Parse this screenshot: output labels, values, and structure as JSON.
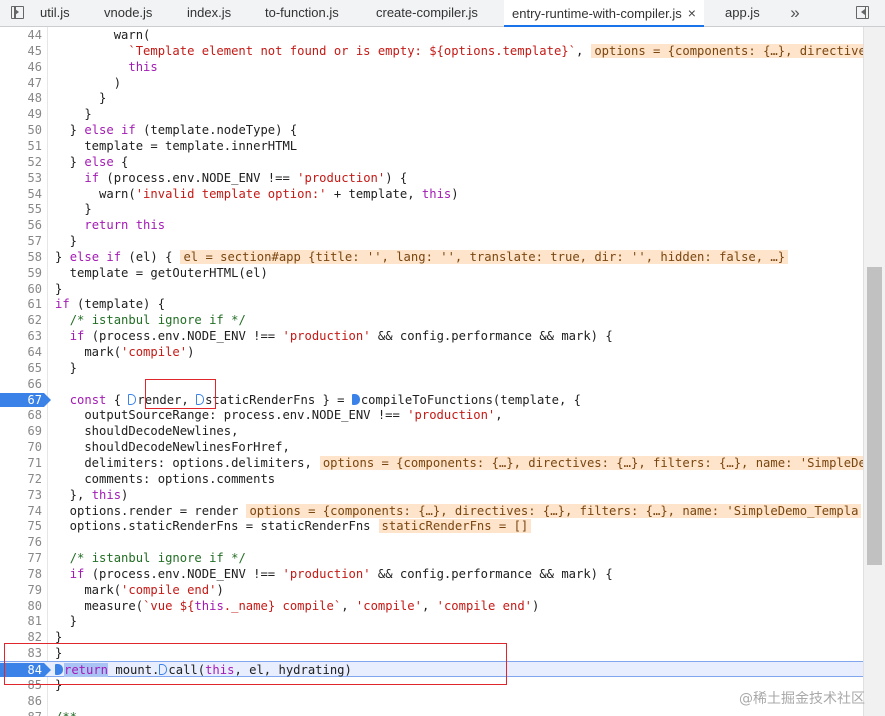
{
  "tabs": [
    {
      "label": "util.js"
    },
    {
      "label": "vnode.js"
    },
    {
      "label": "index.js"
    },
    {
      "label": "to-function.js"
    },
    {
      "label": "create-compiler.js"
    },
    {
      "label": "entry-runtime-with-compiler.js",
      "active": true
    },
    {
      "label": "app.js"
    }
  ],
  "icons": {
    "nav": "navigator-toggle-icon",
    "close": "×",
    "more": "»",
    "toggle_debugger": "debugger-pane-toggle-icon",
    "breakpoint": "breakpoint-marker",
    "inline_breakpoint": "inline-breakpoint-icon"
  },
  "colors": {
    "breakpoint": "#3b82e8",
    "execution_line": "#e8eefe",
    "inline_value": "#fde4cb",
    "highlight_box": "#e0262d"
  },
  "editor": {
    "breakpoint_line": 67,
    "paused_line": 84,
    "lines": [
      {
        "n": "44",
        "segs": [
          [
            "t",
            "        warn("
          ]
        ]
      },
      {
        "n": "45",
        "segs": [
          [
            "t",
            "          "
          ],
          [
            "str",
            "`Template element not found or is empty: ${options.template}`"
          ],
          [
            "t",
            ","
          ],
          [
            "inl",
            "options = {components: {…}, directives: {…}, filters: {…}, name: 'Si"
          ]
        ]
      },
      {
        "n": "46",
        "segs": [
          [
            "t",
            "          "
          ],
          [
            "kw",
            "this"
          ]
        ]
      },
      {
        "n": "47",
        "segs": [
          [
            "t",
            "        )"
          ]
        ]
      },
      {
        "n": "48",
        "segs": [
          [
            "t",
            "      }"
          ]
        ]
      },
      {
        "n": "49",
        "segs": [
          [
            "t",
            "    }"
          ]
        ]
      },
      {
        "n": "50",
        "segs": [
          [
            "t",
            "  } "
          ],
          [
            "kw",
            "else if"
          ],
          [
            "t",
            " (template.nodeType) {"
          ]
        ]
      },
      {
        "n": "51",
        "segs": [
          [
            "t",
            "    template = template.innerHTML"
          ]
        ]
      },
      {
        "n": "52",
        "segs": [
          [
            "t",
            "  } "
          ],
          [
            "kw",
            "else"
          ],
          [
            "t",
            " {"
          ]
        ]
      },
      {
        "n": "53",
        "segs": [
          [
            "t",
            "    "
          ],
          [
            "kw",
            "if"
          ],
          [
            "t",
            " (process.env.NODE_ENV !== "
          ],
          [
            "str",
            "'production'"
          ],
          [
            "t",
            ") {"
          ]
        ]
      },
      {
        "n": "54",
        "segs": [
          [
            "t",
            "      warn("
          ],
          [
            "str",
            "'invalid template option:'"
          ],
          [
            "t",
            " + template, "
          ],
          [
            "kw",
            "this"
          ],
          [
            "t",
            ")"
          ]
        ]
      },
      {
        "n": "55",
        "segs": [
          [
            "t",
            "    }"
          ]
        ]
      },
      {
        "n": "56",
        "segs": [
          [
            "t",
            "    "
          ],
          [
            "kw",
            "return this"
          ]
        ]
      },
      {
        "n": "57",
        "segs": [
          [
            "t",
            "  }"
          ]
        ]
      },
      {
        "n": "58",
        "segs": [
          [
            "t",
            "} "
          ],
          [
            "kw",
            "else if"
          ],
          [
            "t",
            " (el) {"
          ],
          [
            "inl",
            "el = section#app {title: '', lang: '', translate: true, dir: '', hidden: false, …}"
          ]
        ]
      },
      {
        "n": "59",
        "segs": [
          [
            "t",
            "  template = getOuterHTML(el)"
          ]
        ]
      },
      {
        "n": "60",
        "segs": [
          [
            "t",
            "}"
          ]
        ]
      },
      {
        "n": "61",
        "segs": [
          [
            "kw",
            "if"
          ],
          [
            "t",
            " (template) {"
          ]
        ]
      },
      {
        "n": "62",
        "segs": [
          [
            "t",
            "  "
          ],
          [
            "cm",
            "/* istanbul ignore if */"
          ]
        ]
      },
      {
        "n": "63",
        "segs": [
          [
            "t",
            "  "
          ],
          [
            "kw",
            "if"
          ],
          [
            "t",
            " (process.env.NODE_ENV !== "
          ],
          [
            "str",
            "'production'"
          ],
          [
            "t",
            " && config.performance && mark) {"
          ]
        ]
      },
      {
        "n": "64",
        "segs": [
          [
            "t",
            "    mark("
          ],
          [
            "str",
            "'compile'"
          ],
          [
            "t",
            ")"
          ]
        ]
      },
      {
        "n": "65",
        "segs": [
          [
            "t",
            "  }"
          ]
        ]
      },
      {
        "n": "66",
        "segs": []
      },
      {
        "n": "67",
        "segs": [
          [
            "t",
            "  "
          ],
          [
            "kw",
            "const"
          ],
          [
            "t",
            " { "
          ],
          [
            "bk",
            ""
          ],
          [
            "t",
            "render, "
          ],
          [
            "bk",
            ""
          ],
          [
            "t",
            "staticRenderFns } = "
          ],
          [
            "bkf",
            ""
          ],
          [
            "t",
            "compileToFunctions(template, {"
          ]
        ]
      },
      {
        "n": "68",
        "segs": [
          [
            "t",
            "    outputSourceRange: process.env.NODE_ENV !== "
          ],
          [
            "str",
            "'production'"
          ],
          [
            "t",
            ","
          ]
        ]
      },
      {
        "n": "69",
        "segs": [
          [
            "t",
            "    shouldDecodeNewlines,"
          ]
        ]
      },
      {
        "n": "70",
        "segs": [
          [
            "t",
            "    shouldDecodeNewlinesForHref,"
          ]
        ]
      },
      {
        "n": "71",
        "segs": [
          [
            "t",
            "    delimiters: options.delimiters,"
          ],
          [
            "inl",
            "options = {components: {…}, directives: {…}, filters: {…}, name: 'SimpleDemo_Te"
          ]
        ]
      },
      {
        "n": "72",
        "segs": [
          [
            "t",
            "    comments: options.comments"
          ]
        ]
      },
      {
        "n": "73",
        "segs": [
          [
            "t",
            "  }, "
          ],
          [
            "kw",
            "this"
          ],
          [
            "t",
            ")"
          ]
        ]
      },
      {
        "n": "74",
        "segs": [
          [
            "t",
            "  options.render = render"
          ],
          [
            "inl",
            "options = {components: {…}, directives: {…}, filters: {…}, name: 'SimpleDemo_Templa"
          ]
        ]
      },
      {
        "n": "75",
        "segs": [
          [
            "t",
            "  options.staticRenderFns = staticRenderFns"
          ],
          [
            "inl",
            "staticRenderFns = []"
          ]
        ]
      },
      {
        "n": "76",
        "segs": []
      },
      {
        "n": "77",
        "segs": [
          [
            "t",
            "  "
          ],
          [
            "cm",
            "/* istanbul ignore if */"
          ]
        ]
      },
      {
        "n": "78",
        "segs": [
          [
            "t",
            "  "
          ],
          [
            "kw",
            "if"
          ],
          [
            "t",
            " (process.env.NODE_ENV !== "
          ],
          [
            "str",
            "'production'"
          ],
          [
            "t",
            " && config.performance && mark) {"
          ]
        ]
      },
      {
        "n": "79",
        "segs": [
          [
            "t",
            "    mark("
          ],
          [
            "str",
            "'compile end'"
          ],
          [
            "t",
            ")"
          ]
        ]
      },
      {
        "n": "80",
        "segs": [
          [
            "t",
            "    measure("
          ],
          [
            "str",
            "`vue ${"
          ],
          [
            "kw",
            "this"
          ],
          [
            "str",
            "._name} compile`"
          ],
          [
            "t",
            ", "
          ],
          [
            "str",
            "'compile'"
          ],
          [
            "t",
            ", "
          ],
          [
            "str",
            "'compile end'"
          ],
          [
            "t",
            ")"
          ]
        ]
      },
      {
        "n": "81",
        "segs": [
          [
            "t",
            "  }"
          ]
        ]
      },
      {
        "n": "82",
        "segs": [
          [
            "t",
            "}"
          ]
        ]
      },
      {
        "n": "83",
        "segs": [
          [
            "t",
            "}"
          ]
        ]
      },
      {
        "n": "84",
        "segs": [
          [
            "bkf",
            ""
          ],
          [
            "ret",
            "return"
          ],
          [
            "t",
            " mount."
          ],
          [
            "bk",
            ""
          ],
          [
            "t",
            "call("
          ],
          [
            "kw",
            "this"
          ],
          [
            "t",
            ", el, hydrating)"
          ]
        ]
      },
      {
        "n": "85",
        "segs": [
          [
            "t",
            "}"
          ]
        ]
      },
      {
        "n": "86",
        "segs": []
      },
      {
        "n": "87",
        "segs": [
          [
            "cm",
            "/**"
          ]
        ]
      }
    ]
  },
  "watermark": "@稀土掘金技术社区"
}
